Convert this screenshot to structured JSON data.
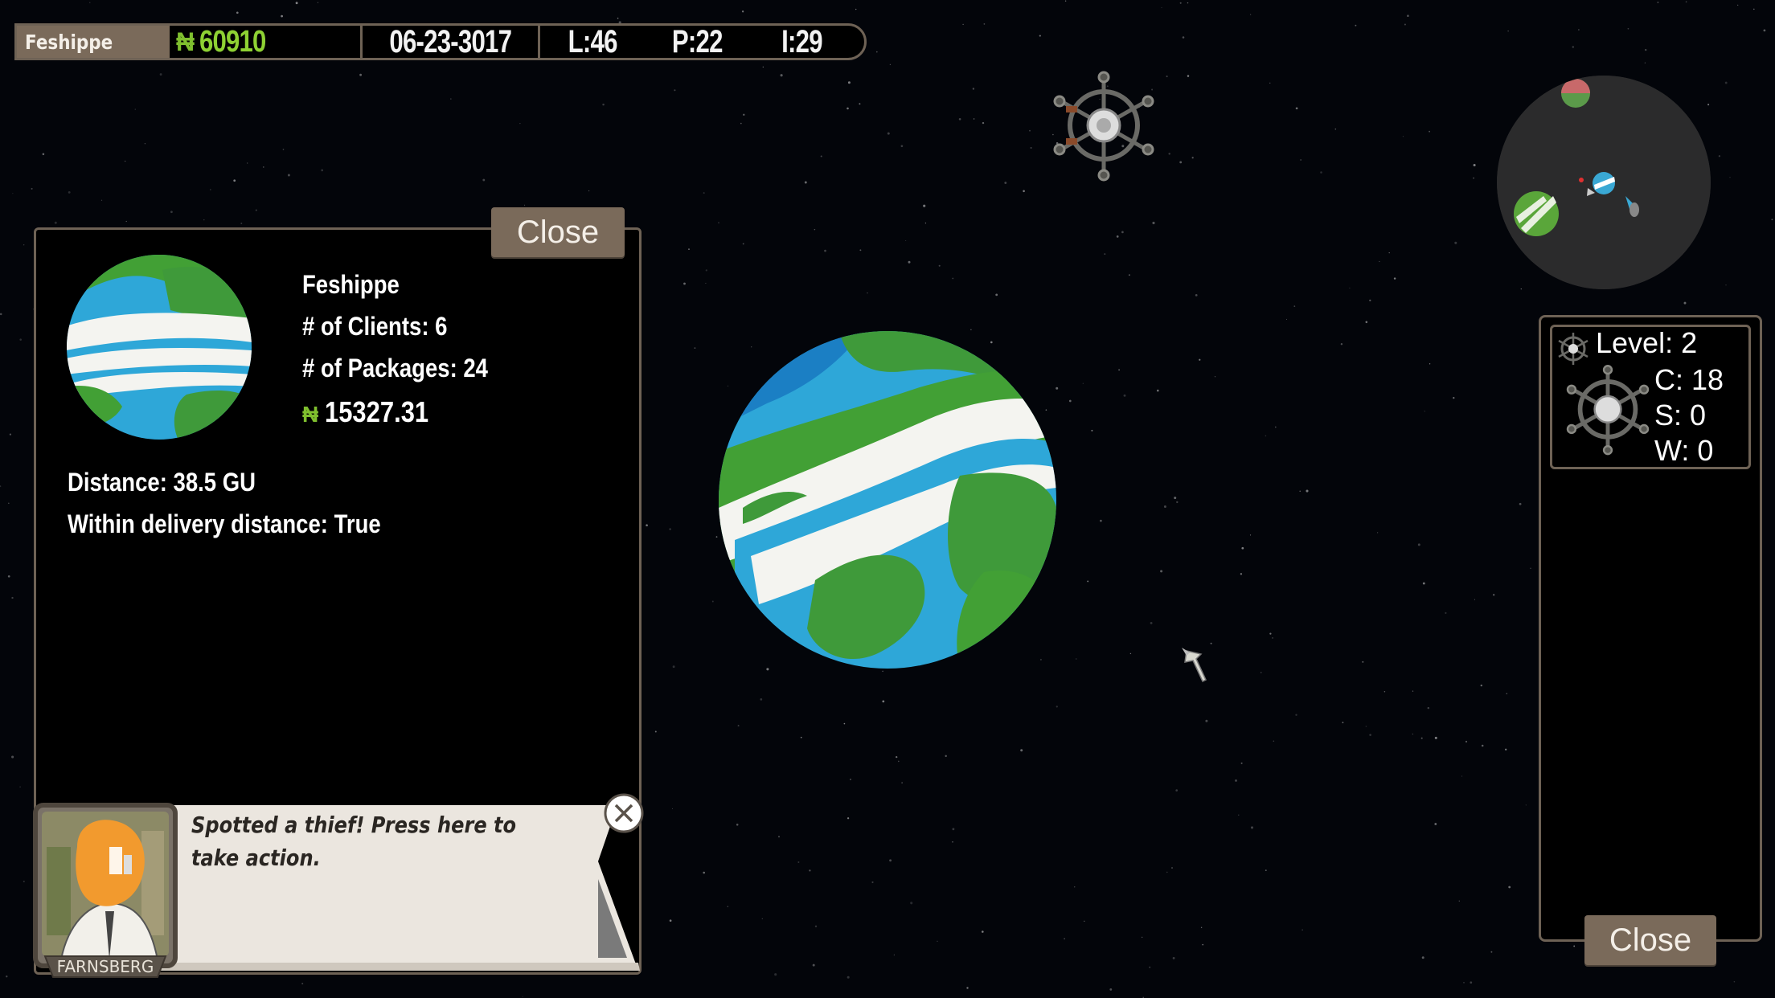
{
  "topbar": {
    "planet": "Feshippe",
    "currency_symbol": "₦",
    "money": "60910",
    "date": "06-23-3017",
    "level": "L:46",
    "packages": "P:22",
    "i_stat": "I:29"
  },
  "info_panel": {
    "close_label": "Close",
    "planet_name": "Feshippe",
    "clients": "# of Clients: 6",
    "packages": "# of Packages: 24",
    "currency_symbol": "₦",
    "value": "15327.31",
    "distance": "Distance: 38.5 GU",
    "within_delivery": "Within delivery distance: True"
  },
  "notification": {
    "text": "Spotted a thief! Press here to take action.",
    "avatar_label": "FARNSBERG",
    "close_icon": "x-circle-icon"
  },
  "station_panel": {
    "level": "Level: 2",
    "c": "C: 18",
    "s": "S: 0",
    "w": "W: 0",
    "close_label": "Close"
  },
  "colors": {
    "panel_border": "#6e6255",
    "button_bg": "#7a6a5a",
    "money_green": "#8ed133",
    "notification_bg": "#ebe6df"
  }
}
